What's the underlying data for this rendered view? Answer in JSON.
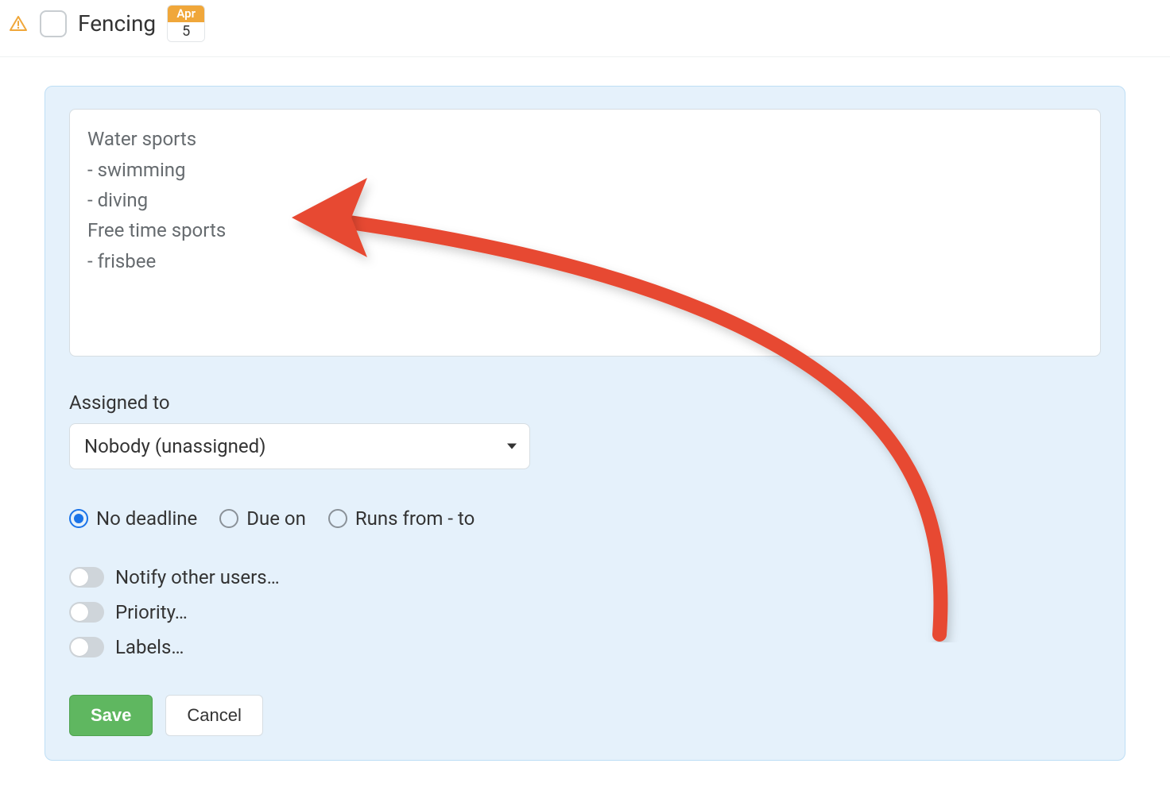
{
  "task": {
    "title": "Fencing",
    "date": {
      "month": "Apr",
      "day": "5"
    }
  },
  "description": "Water sports\n- swimming\n- diving\nFree time sports\n- frisbee",
  "assigned": {
    "label": "Assigned to",
    "value": "Nobody (unassigned)"
  },
  "deadline": {
    "options": [
      {
        "label": "No deadline",
        "selected": true
      },
      {
        "label": "Due on",
        "selected": false
      },
      {
        "label": "Runs from - to",
        "selected": false
      }
    ]
  },
  "toggles": [
    {
      "label": "Notify other users…"
    },
    {
      "label": "Priority…"
    },
    {
      "label": "Labels…"
    }
  ],
  "buttons": {
    "save": "Save",
    "cancel": "Cancel"
  }
}
